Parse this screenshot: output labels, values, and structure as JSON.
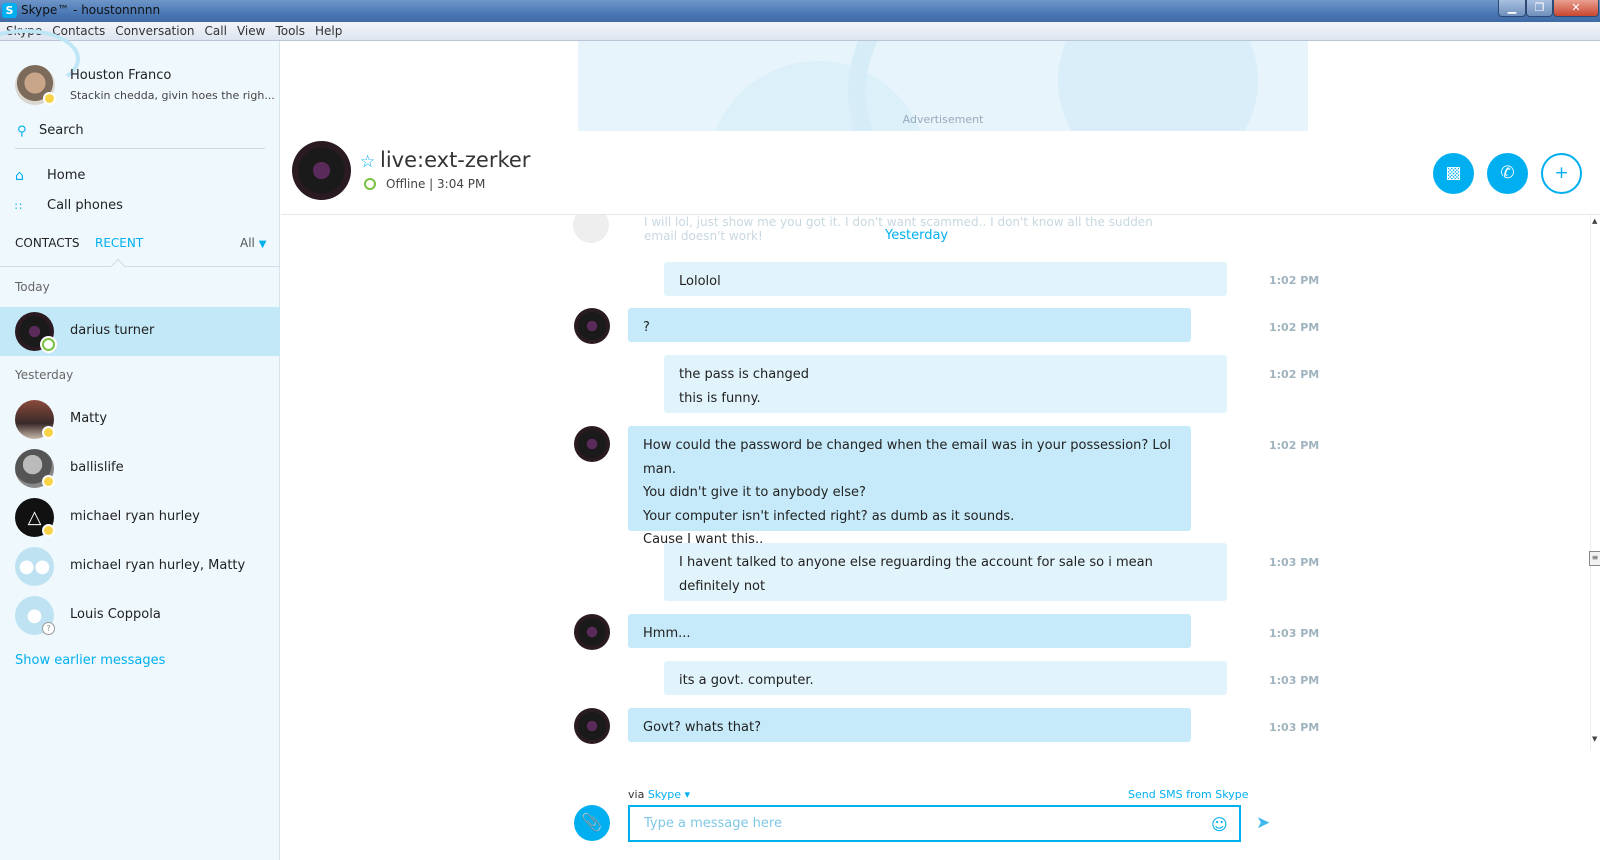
{
  "window": {
    "title": "Skype™ - houstonnnnn",
    "app_icon": "S"
  },
  "menu": [
    "Skype",
    "Contacts",
    "Conversation",
    "Call",
    "View",
    "Tools",
    "Help"
  ],
  "me": {
    "name": "Houston Franco",
    "mood": "Stackin chedda, givin hoes the righ...",
    "status": "away"
  },
  "sidebar": {
    "search_label": "Search",
    "nav": [
      {
        "label": "Home",
        "icon": "home-icon"
      },
      {
        "label": "Call phones",
        "icon": "dialpad-icon"
      }
    ],
    "tabs": {
      "contacts": "CONTACTS",
      "recent": "RECENT",
      "filter": "All"
    },
    "sections": {
      "today": "Today",
      "yesterday": "Yesterday"
    },
    "today_contacts": [
      {
        "name": "darius turner",
        "status": "online",
        "active": true
      }
    ],
    "yesterday_contacts": [
      {
        "name": "Matty",
        "status": "away"
      },
      {
        "name": "ballislife",
        "status": "away"
      },
      {
        "name": "michael ryan hurley",
        "status": "away"
      },
      {
        "name": "michael ryan hurley, Matty",
        "status": "group"
      },
      {
        "name": "Louis Coppola",
        "status": "unknown"
      }
    ],
    "show_earlier": "Show earlier messages"
  },
  "ad": {
    "label": "Advertisement"
  },
  "conversation": {
    "name": "live:ext-zerker",
    "presence": "Offline | 3:04 PM",
    "day_separator": "Yesterday",
    "ghost_text": "I will lol, just show me you got it. I don't want scammed.. I don't know all the sudden email doesn't work!"
  },
  "messages": [
    {
      "dir": "out",
      "lines": [
        "Lololol"
      ],
      "time": "1:02 PM"
    },
    {
      "dir": "in",
      "lines": [
        "?"
      ],
      "time": "1:02 PM"
    },
    {
      "dir": "out",
      "lines": [
        "the pass is changed",
        "this is funny."
      ],
      "time": "1:02 PM"
    },
    {
      "dir": "in",
      "lines": [
        "How could the password be changed when the email was in your possession? Lol man.",
        "You didn't give it to anybody else?",
        "Your computer isn't infected right? as dumb as it sounds.",
        "Cause I want this.."
      ],
      "time": "1:02 PM"
    },
    {
      "dir": "out",
      "lines": [
        "I havent talked to anyone else reguarding the account for sale so i mean",
        "definitely not"
      ],
      "time": "1:03 PM"
    },
    {
      "dir": "in",
      "lines": [
        "Hmm..."
      ],
      "time": "1:03 PM"
    },
    {
      "dir": "out",
      "lines": [
        "its a govt. computer."
      ],
      "time": "1:03 PM"
    },
    {
      "dir": "in",
      "lines": [
        "Govt? whats that?"
      ],
      "time": "1:03 PM"
    }
  ],
  "compose": {
    "via_label": "via",
    "via_service": "Skype",
    "sms_link": "Send SMS from Skype",
    "placeholder": "Type a message here"
  },
  "colors": {
    "accent": "#00aff0",
    "bubble_in": "#c6eaf9",
    "bubble_out": "#e1f3fb",
    "sidebar_bg": "#eff8fc"
  }
}
